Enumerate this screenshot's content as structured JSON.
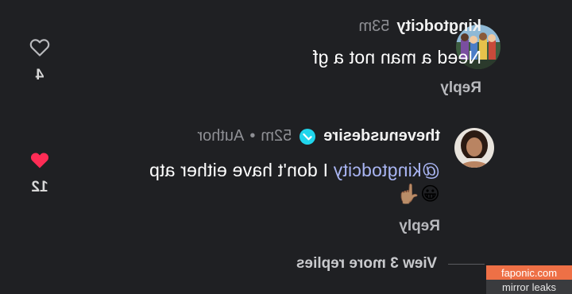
{
  "comments": [
    {
      "username": "kingtodcity",
      "time": "53m",
      "text": "Need a man not a gf",
      "reply_label": "Reply",
      "like_count": "4",
      "liked": false,
      "avatar_icon": "cartoon-group-avatar"
    },
    {
      "username": "thevenusdesire",
      "time": "52m",
      "separator": "•",
      "badge": "Author",
      "verified": true,
      "mention": "@kingtodcity",
      "text": " I don't have either atp",
      "emojis": "😀👆🏽",
      "reply_label": "Reply",
      "like_count": "12",
      "liked": true,
      "avatar_icon": "portrait-avatar"
    }
  ],
  "view_more": "View 3 more replies",
  "watermark": {
    "site": "faponic.com",
    "tagline": "mirror leaks"
  },
  "colors": {
    "background": "#1f2023",
    "like_active": "#fe2c55",
    "mention": "#a9b5f3",
    "verified": "#20d5ec",
    "watermark": "#ee7046"
  }
}
